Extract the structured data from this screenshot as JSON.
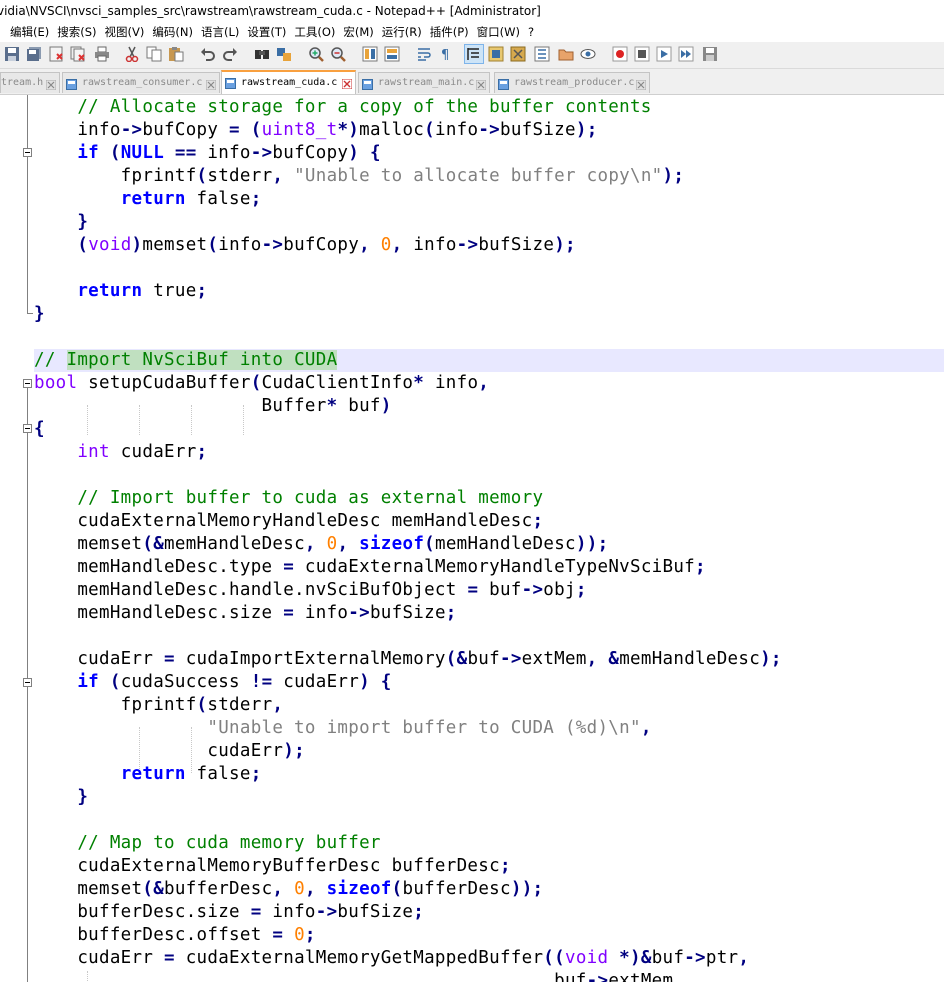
{
  "window": {
    "title": "vidia\\NVSCI\\nvsci_samples_src\\rawstream\\rawstream_cuda.c - Notepad++ [Administrator]"
  },
  "menu": [
    "编辑(E)",
    "搜索(S)",
    "视图(V)",
    "编码(N)",
    "语言(L)",
    "设置(T)",
    "工具(O)",
    "宏(M)",
    "运行(R)",
    "插件(P)",
    "窗口(W)",
    "?"
  ],
  "toolbar_icons": [
    "save-all-icon",
    "save-icon",
    "close-icon",
    "close-all-icon",
    "print-icon",
    "cut-icon",
    "copy-icon",
    "paste-icon",
    "undo-icon",
    "redo-icon",
    "find-icon",
    "replace-icon",
    "zoom-in-icon",
    "zoom-out-icon",
    "sync-v-icon",
    "sync-h-icon",
    "word-wrap-icon",
    "all-chars-icon",
    "indent-guide-icon",
    "udl-icon",
    "doc-map-icon",
    "function-list-icon",
    "folder-workspace-icon",
    "monitor-icon",
    "record-macro-icon",
    "stop-record-icon",
    "play-macro-icon",
    "run-macro-multiple-icon",
    "save-macro-icon"
  ],
  "tabs": [
    {
      "label": "tream.h",
      "active": false
    },
    {
      "label": "rawstream_consumer.c",
      "active": false
    },
    {
      "label": "rawstream_cuda.c",
      "active": true
    },
    {
      "label": "rawstream_main.c",
      "active": false
    },
    {
      "label": "rawstream_producer.c",
      "active": false
    }
  ],
  "code": {
    "l01": "    // Allocate storage for a copy of the buffer contents",
    "l02": "    info->bufCopy = (uint8_t*)malloc(info->bufSize);",
    "l03": "    if (NULL == info->bufCopy) {",
    "l04": "        fprintf(stderr, \"Unable to allocate buffer copy\\n\");",
    "l05": "        return false;",
    "l06": "    }",
    "l07": "    (void)memset(info->bufCopy, 0, info->bufSize);",
    "l08": "",
    "l09": "    return true;",
    "l10": "}",
    "l11": "",
    "l12": "// Import NvSciBuf into CUDA",
    "l13": "bool setupCudaBuffer(CudaClientInfo* info,",
    "l14": "                     Buffer* buf)",
    "l15": "{",
    "l16": "    int cudaErr;",
    "l17": "",
    "l18": "    // Import buffer to cuda as external memory",
    "l19": "    cudaExternalMemoryHandleDesc memHandleDesc;",
    "l20": "    memset(&memHandleDesc, 0, sizeof(memHandleDesc));",
    "l21": "    memHandleDesc.type = cudaExternalMemoryHandleTypeNvSciBuf;",
    "l22": "    memHandleDesc.handle.nvSciBufObject = buf->obj;",
    "l23": "    memHandleDesc.size = info->bufSize;",
    "l24": "",
    "l25": "    cudaErr = cudaImportExternalMemory(&buf->extMem, &memHandleDesc);",
    "l26": "    if (cudaSuccess != cudaErr) {",
    "l27": "        fprintf(stderr,",
    "l28": "                \"Unable to import buffer to CUDA (%d)\\n\",",
    "l29": "                cudaErr);",
    "l30": "        return false;",
    "l31": "    }",
    "l32": "",
    "l33": "    // Map to cuda memory buffer",
    "l34": "    cudaExternalMemoryBufferDesc bufferDesc;",
    "l35": "    memset(&bufferDesc, 0, sizeof(bufferDesc));",
    "l36": "    bufferDesc.size = info->bufSize;",
    "l37": "    bufferDesc.offset = 0;",
    "l38": "    cudaErr = cudaExternalMemoryGetMappedBuffer((void *)&buf->ptr,",
    "l39": "                                                buf->extMem,"
  },
  "colors": {
    "keyword": "#0000ff",
    "type": "#8000ff",
    "comment": "#008000",
    "string": "#808080",
    "number": "#ff8000",
    "caret_line": "#e8e8ff",
    "active_tab_accent": "#f9a03f"
  }
}
